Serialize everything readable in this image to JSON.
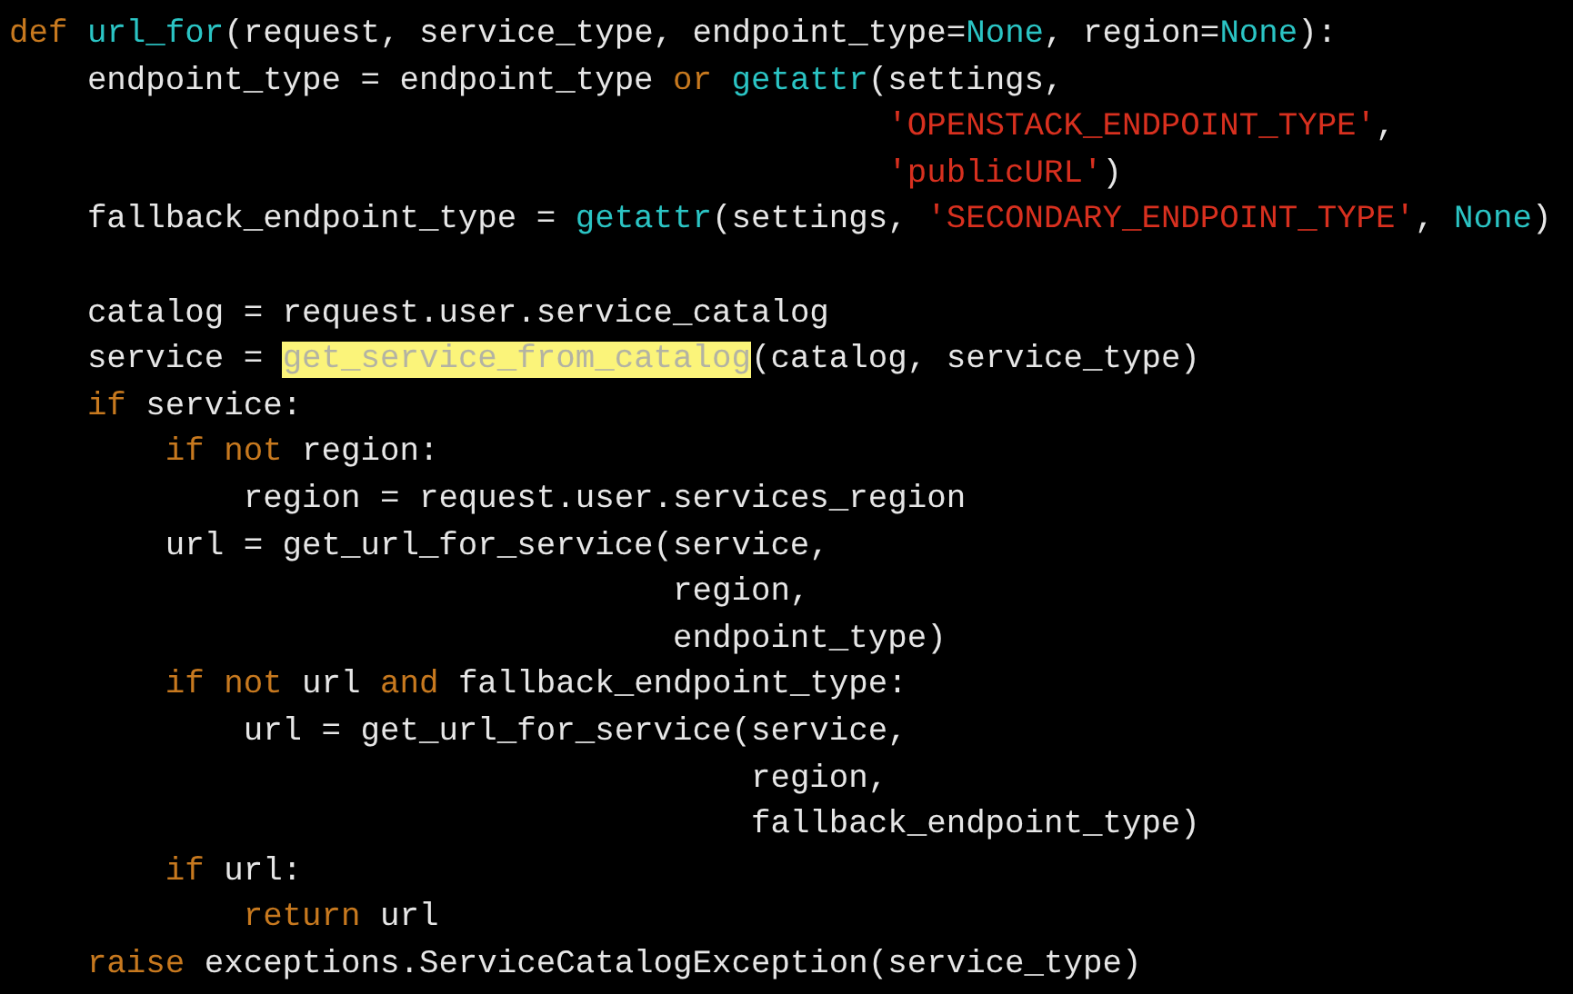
{
  "code_lines": [
    {
      "kind": "code",
      "tokens": [
        {
          "kind": "keyword",
          "text": "def "
        },
        {
          "kind": "builtin",
          "text": "url_for"
        },
        {
          "kind": "plain",
          "text": "(request, service_type, endpoint_type="
        },
        {
          "kind": "builtin",
          "text": "None"
        },
        {
          "kind": "plain",
          "text": ", region="
        },
        {
          "kind": "builtin",
          "text": "None"
        },
        {
          "kind": "plain",
          "text": "):"
        }
      ]
    },
    {
      "kind": "code",
      "tokens": [
        {
          "kind": "plain",
          "text": "    endpoint_type = endpoint_type "
        },
        {
          "kind": "keyword",
          "text": "or "
        },
        {
          "kind": "builtin",
          "text": "getattr"
        },
        {
          "kind": "plain",
          "text": "(settings,"
        }
      ]
    },
    {
      "kind": "code",
      "tokens": [
        {
          "kind": "string",
          "text": "                                             'OPENSTACK_ENDPOINT_TYPE'"
        },
        {
          "kind": "plain",
          "text": ","
        }
      ]
    },
    {
      "kind": "code",
      "tokens": [
        {
          "kind": "string",
          "text": "                                             'publicURL'"
        },
        {
          "kind": "plain",
          "text": ")"
        }
      ]
    },
    {
      "kind": "code",
      "tokens": [
        {
          "kind": "plain",
          "text": "    fallback_endpoint_type = "
        },
        {
          "kind": "builtin",
          "text": "getattr"
        },
        {
          "kind": "plain",
          "text": "(settings, "
        },
        {
          "kind": "string",
          "text": "'SECONDARY_ENDPOINT_TYPE'"
        },
        {
          "kind": "plain",
          "text": ", "
        },
        {
          "kind": "builtin",
          "text": "None"
        },
        {
          "kind": "plain",
          "text": ")"
        }
      ]
    },
    {
      "kind": "blank"
    },
    {
      "kind": "code",
      "tokens": [
        {
          "kind": "plain",
          "text": "    catalog = request.user.service_catalog"
        }
      ]
    },
    {
      "kind": "code",
      "tokens": [
        {
          "kind": "plain",
          "text": "    service = "
        },
        {
          "kind": "match",
          "text": "get_service_from_catalog"
        },
        {
          "kind": "plain",
          "text": "(catalog, service_type)"
        }
      ]
    },
    {
      "kind": "code",
      "tokens": [
        {
          "kind": "keyword",
          "text": "    if "
        },
        {
          "kind": "plain",
          "text": "service:"
        }
      ]
    },
    {
      "kind": "code",
      "tokens": [
        {
          "kind": "keyword",
          "text": "        if not "
        },
        {
          "kind": "plain",
          "text": "region:"
        }
      ]
    },
    {
      "kind": "code",
      "tokens": [
        {
          "kind": "plain",
          "text": "            region = request.user.services_region"
        }
      ]
    },
    {
      "kind": "code",
      "tokens": [
        {
          "kind": "plain",
          "text": "        url = get_url_for_service(service,"
        }
      ]
    },
    {
      "kind": "code",
      "tokens": [
        {
          "kind": "plain",
          "text": "                                  region,"
        }
      ]
    },
    {
      "kind": "code",
      "tokens": [
        {
          "kind": "plain",
          "text": "                                  endpoint_type)"
        }
      ]
    },
    {
      "kind": "code",
      "tokens": [
        {
          "kind": "keyword",
          "text": "        if not "
        },
        {
          "kind": "plain",
          "text": "url "
        },
        {
          "kind": "keyword",
          "text": "and "
        },
        {
          "kind": "plain",
          "text": "fallback_endpoint_type:"
        }
      ]
    },
    {
      "kind": "code",
      "tokens": [
        {
          "kind": "plain",
          "text": "            url = get_url_for_service(service,"
        }
      ]
    },
    {
      "kind": "code",
      "tokens": [
        {
          "kind": "plain",
          "text": "                                      region,"
        }
      ]
    },
    {
      "kind": "code",
      "tokens": [
        {
          "kind": "plain",
          "text": "                                      fallback_endpoint_type)"
        }
      ]
    },
    {
      "kind": "code",
      "tokens": [
        {
          "kind": "keyword",
          "text": "        if "
        },
        {
          "kind": "plain",
          "text": "url:"
        }
      ]
    },
    {
      "kind": "code",
      "tokens": [
        {
          "kind": "keyword",
          "text": "            return "
        },
        {
          "kind": "plain",
          "text": "url"
        }
      ]
    },
    {
      "kind": "code",
      "tokens": [
        {
          "kind": "keyword",
          "text": "    raise "
        },
        {
          "kind": "plain",
          "text": "exceptions.ServiceCatalogException(service_type)"
        }
      ]
    }
  ]
}
